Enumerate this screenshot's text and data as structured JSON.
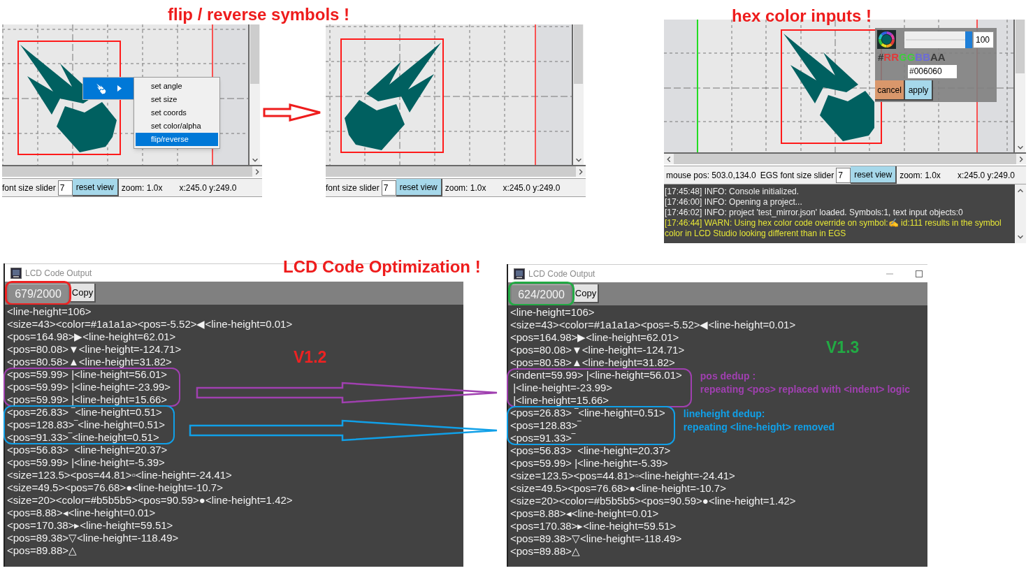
{
  "flip_section": {
    "title": "flip / reverse symbols !",
    "before_view": {
      "context_menu": {
        "items": [
          {
            "label": "set angle",
            "selected": false
          },
          {
            "label": "set size",
            "selected": false
          },
          {
            "label": "set coords",
            "selected": false
          },
          {
            "label": "set color/alpha",
            "selected": false
          },
          {
            "label": "flip/reverse",
            "selected": true
          }
        ]
      },
      "status_bar": {
        "slider_label": "font size slider",
        "slider_value": "7",
        "reset_button": "reset view",
        "zoom": "zoom: 1.0x",
        "coords": "x:245.0 y:249.0"
      }
    },
    "after_view": {
      "status_bar": {
        "slider_label": "font size slider",
        "slider_value": "7",
        "reset_button": "reset view",
        "zoom": "zoom: 1.0x",
        "coords": "x:245.0 y:249.0"
      }
    }
  },
  "hex_section": {
    "title": "hex color inputs !",
    "color_popup": {
      "level": 1,
      "alpha_value": "100",
      "format_label": [
        {
          "text": "#",
          "color": "#3a3a3a"
        },
        {
          "text": "RR",
          "color": "#e03a3a"
        },
        {
          "text": "GG",
          "color": "#3ccf3c"
        },
        {
          "text": "BB",
          "color": "#6a6ad8"
        },
        {
          "text": "AA",
          "color": "#3a3a3a"
        }
      ],
      "hex_value": "#006060",
      "buttons": [
        {
          "label": "cancel",
          "kind": "cancel"
        },
        {
          "label": "apply",
          "kind": "apply"
        }
      ]
    },
    "status_bar": {
      "mouse_pos": "mouse pos: 503.0,134.0",
      "slider_label": "EGS font size slider",
      "slider_value": "7",
      "reset_button": "reset view",
      "zoom": "zoom: 1.0x",
      "coords": "x:245.0 y:249.0"
    },
    "console": [
      {
        "text": "[17:45:48] INFO: Console initialized.",
        "kind": "info"
      },
      {
        "text": "[17:46:00] INFO: Opening a project...",
        "kind": "info"
      },
      {
        "text": "[17:46:02] INFO: project 'test_mirror.json' loaded. Symbols:1, text input objects:0",
        "kind": "info"
      },
      {
        "text": "[17:46:44] WARN: Using hex color code override on symbol:✍ id:111 results in the symbol color in LCD Studio looking different than in EGS",
        "kind": "warn"
      }
    ]
  },
  "optimization_section": {
    "title": "LCD Code Optimization !",
    "arrows": [
      {
        "color": "#a040b0"
      },
      {
        "color": "#10a0e8"
      }
    ],
    "windows": [
      {
        "title": "LCD Code Output",
        "char_count": "679/2000",
        "copy_button": "Copy",
        "version": "V1.2",
        "color": "#ee2222",
        "lines": [
          "<line-height=106>",
          "<size=43><color=#1a1a1a><pos=-5.52>◀<line-height=0.01>",
          "<pos=164.98>▶<line-height=62.01>",
          "<pos=80.08>▼<line-height=-124.71>",
          "<pos=80.58>▲<line-height=31.82>",
          {
            "kind": "group",
            "color": "#a040b0",
            "lines": [
              "<pos=59.99> |<line-height=56.01>",
              "<pos=59.99> |<line-height=-23.99>",
              "<pos=59.99> |<line-height=15.66>"
            ]
          },
          {
            "kind": "group",
            "color": "#10a0e8",
            "lines": [
              "<pos=26.83> ‾<line-height=0.51>",
              "<pos=128.83>‾<line-height=0.51>",
              "<pos=91.33>‾<line-height=0.51>"
            ]
          },
          "<pos=56.83>  <line-height=20.37>",
          "<pos=59.99> |<line-height=-5.39>",
          "<size=123.5><pos=44.81>▫<line-height=-24.41>",
          "<size=49.5><pos=76.68>●<line-height=-10.7>",
          "<size=20><color=#b5b5b5><pos=90.59>●<line-height=1.42>",
          "<pos=8.88>◂<line-height=0.01>",
          "<pos=170.38>▸<line-height=59.51>",
          "<pos=89.38>▽<line-height=-118.49>",
          "<pos=89.88>△"
        ]
      },
      {
        "title": "LCD Code Output",
        "char_count": "624/2000",
        "copy_button": "Copy",
        "version": "V1.3",
        "color": "#22aa44",
        "lines": [
          "<line-height=106>",
          "<size=43><color=#1a1a1a><pos=-5.52>◀<line-height=0.01>",
          "<pos=164.98>▶<line-height=62.01>",
          "<pos=80.08>▼<line-height=-124.71>",
          "<pos=80.58>▲<line-height=31.82>",
          {
            "kind": "group",
            "color": "#a040b0",
            "lines": [
              "<indent=59.99> |<line-height=56.01>",
              " |<line-height=-23.99>",
              " |<line-height=15.66>"
            ],
            "note": {
              "title": "pos dedup :",
              "text": "repeating <pos> replaced with <indent> logic"
            }
          },
          {
            "kind": "group",
            "color": "#10a0e8",
            "lines": [
              "<pos=26.83> ‾<line-height=0.51>",
              "<pos=128.83>‾",
              "<pos=91.33>‾"
            ],
            "note": {
              "title": "lineheight dedup:",
              "text": "repeating <line-height> removed"
            }
          },
          "<pos=56.83>  <line-height=20.37>",
          "<pos=59.99> |<line-height=-5.39>",
          "<size=123.5><pos=44.81>▫<line-height=-24.41>",
          "<size=49.5><pos=76.68>●<line-height=-10.7>",
          "<size=20><color=#b5b5b5><pos=90.59>●<line-height=1.42>",
          "<pos=8.88>◂<line-height=0.01>",
          "<pos=170.38>▸<line-height=59.51>",
          "<pos=89.38>▽<line-height=-118.49>",
          "<pos=89.88>△"
        ]
      }
    ]
  }
}
